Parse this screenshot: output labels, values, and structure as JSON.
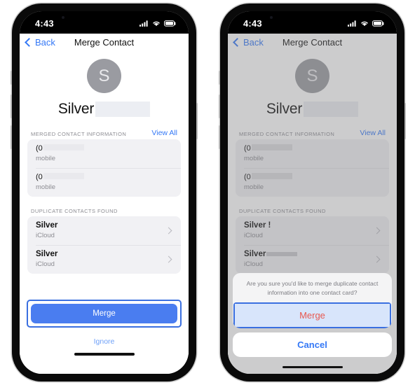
{
  "status_bar": {
    "time": "4:43",
    "cellular_icon": "cellular-bars-icon",
    "wifi_icon": "wifi-icon",
    "battery_icon": "battery-icon"
  },
  "nav": {
    "back_label": "Back",
    "title": "Merge Contact"
  },
  "contact": {
    "avatar_initial": "S",
    "first_name": "Silver",
    "last_name_redacted": true
  },
  "merged_section": {
    "label": "MERGED CONTACT INFORMATION",
    "view_all_label": "View All",
    "rows": [
      {
        "value": "(0",
        "redacted": true,
        "label": "mobile"
      },
      {
        "value": "(0",
        "redacted": true,
        "label": "mobile"
      }
    ]
  },
  "duplicates_section": {
    "label": "DUPLICATE CONTACTS FOUND",
    "rows": [
      {
        "name": "Silver",
        "name_suffix": "",
        "account": "iCloud",
        "chevron": "chevron-right-icon"
      },
      {
        "name": "Silver",
        "name_suffix": "",
        "account": "iCloud",
        "chevron": "chevron-right-icon"
      }
    ],
    "rows_right": [
      {
        "name": "Silver !",
        "name_suffix": "",
        "account": "iCloud",
        "chevron": "chevron-right-icon"
      },
      {
        "name": "Silver",
        "name_suffix": "redacted",
        "account": "iCloud",
        "chevron": "chevron-right-icon"
      }
    ]
  },
  "footer": {
    "merge_label": "Merge",
    "ignore_label": "Ignore"
  },
  "action_sheet": {
    "message": "Are you sure you'd like to merge duplicate contact information into one contact card?",
    "merge_label": "Merge",
    "cancel_label": "Cancel"
  },
  "colors": {
    "ios_blue": "#3478f6",
    "merge_button_blue": "#4a7df0",
    "annotation_blue": "#3a6fe0",
    "destructive_red": "#e8584f",
    "avatar_gray": "#9a9ba1",
    "card_gray": "#f1f1f4",
    "secondary_text": "#8c8c92"
  }
}
